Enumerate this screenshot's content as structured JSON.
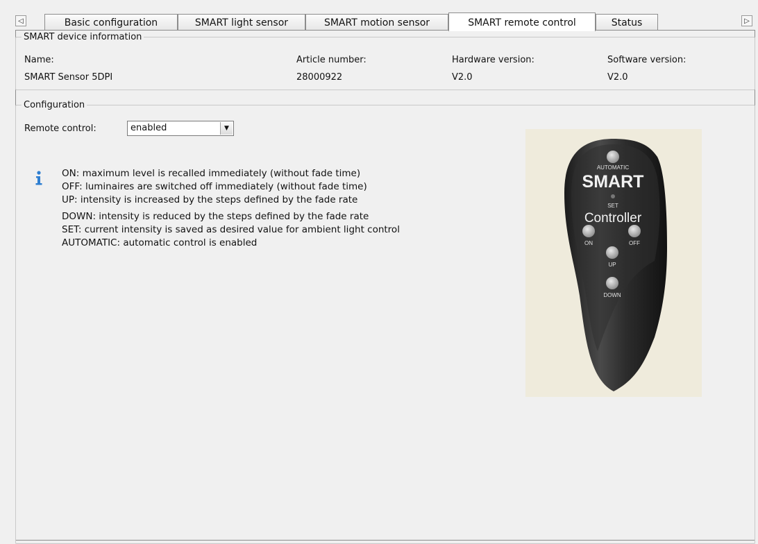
{
  "tabs": [
    {
      "label": "Basic configuration",
      "active": false
    },
    {
      "label": "SMART light sensor",
      "active": false
    },
    {
      "label": "SMART motion sensor",
      "active": false
    },
    {
      "label": "SMART remote control",
      "active": true
    },
    {
      "label": "Status",
      "active": false
    }
  ],
  "device_info": {
    "legend": "SMART device information",
    "name_label": "Name:",
    "name_value": "SMART Sensor 5DPI",
    "article_label": "Article number:",
    "article_value": "28000922",
    "hardware_label": "Hardware version:",
    "hardware_value": "V2.0",
    "software_label": "Software version:",
    "software_value": "V2.0"
  },
  "configuration": {
    "legend": "Configuration",
    "remote_label": "Remote control:",
    "remote_value": "enabled",
    "info_lines": [
      "ON: maximum level is recalled immediately (without fade time)",
      "OFF: luminaires are switched off immediately (without fade time)",
      "UP: intensity is increased by the steps defined by the fade rate",
      "DOWN: intensity is reduced by the steps defined by the fade rate",
      "SET: current intensity is saved as desired value for ambient light control",
      "AUTOMATIC: automatic control is enabled"
    ]
  },
  "remote_image": {
    "automatic": "AUTOMATIC",
    "brand": "SMART",
    "set": "SET",
    "model": "Controller",
    "on": "ON",
    "off": "OFF",
    "up": "UP",
    "down": "DOWN"
  },
  "icons": {
    "scroll_left": "triangle-left-icon",
    "scroll_right": "triangle-right-icon",
    "info": "info-icon",
    "dropdown": "chevron-down-icon"
  }
}
